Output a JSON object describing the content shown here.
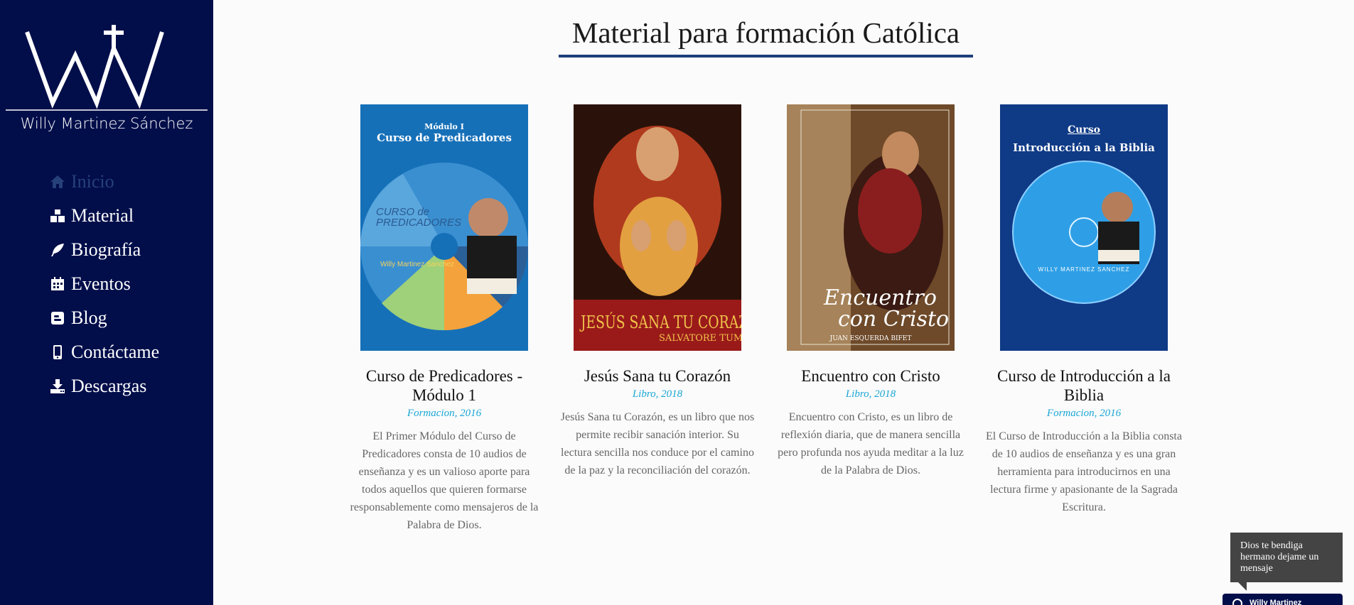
{
  "brand": {
    "name": "Willy Martinez Sánchez"
  },
  "nav": {
    "items": [
      {
        "label": "Inicio",
        "icon": "home-icon",
        "active": true
      },
      {
        "label": "Material",
        "icon": "cubes-icon",
        "active": false
      },
      {
        "label": "Biografía",
        "icon": "feather-icon",
        "active": false
      },
      {
        "label": "Eventos",
        "icon": "calendar-icon",
        "active": false
      },
      {
        "label": "Blog",
        "icon": "blogger-icon",
        "active": false
      },
      {
        "label": "Contáctame",
        "icon": "mobile-icon",
        "active": false
      },
      {
        "label": "Descargas",
        "icon": "download-icon",
        "active": false
      }
    ]
  },
  "page": {
    "title": "Material para formación Católica"
  },
  "cards": [
    {
      "title": "Curso de Predicadores - Módulo 1",
      "meta": "Formacion, 2016",
      "description": "El Primer Módulo del Curso de Predicadores consta de 10 audios de enseñanza y es un valioso aporte para todos aquellos que quieren formarse responsablemente como mensajeros de la Palabra de Dios.",
      "cover": {
        "line1": "Módulo I",
        "line2": "Curso de Predicadores",
        "disc_text1": "CURSO de",
        "disc_text2": "PREDICADORES",
        "disc_text3": "Willy Martinez Sanchez"
      }
    },
    {
      "title": "Jesús Sana tu Corazón",
      "meta": "Libro, 2018",
      "description": "Jesús Sana tu Corazón, es un libro que nos permite recibir sanación interior. Su lectura sencilla nos conduce por el camino de la paz y la reconciliación del corazón.",
      "cover": {
        "line1": "JESÚS SANA TU CORAZÓN",
        "line2": "SALVATORE TUMIN"
      }
    },
    {
      "title": "Encuentro con Cristo",
      "meta": "Libro, 2018",
      "description": "Encuentro con Cristo, es un libro de reflexión diaria, que de manera sencilla pero profunda nos ayuda meditar a la luz de la Palabra de Dios.",
      "cover": {
        "line1": "Encuentro",
        "line2": "con Cristo",
        "line3": "JUAN ESQUERDA BIFET"
      }
    },
    {
      "title": "Curso de Introducción a la Biblia",
      "meta": "Formacion, 2016",
      "description": "El Curso de Introducción a la Biblia consta de 10 audios de enseñanza y es una gran herramienta para introducirnos en una lectura firme y apasionante de la Sagrada Escritura.",
      "cover": {
        "line1": "Curso",
        "line2": "Introducción a la Biblia",
        "disc_text": "WILLY MARTINEZ SANCHEZ"
      }
    }
  ],
  "chat": {
    "bubble_text": "Dios te bendiga hermano dejame un mensaje",
    "bar_text": "Willy Martinez"
  },
  "colors": {
    "sidebar": "#020e4a",
    "active_nav": "#26407a",
    "accent": "#19a6d6",
    "underline": "#1f3f7a"
  }
}
